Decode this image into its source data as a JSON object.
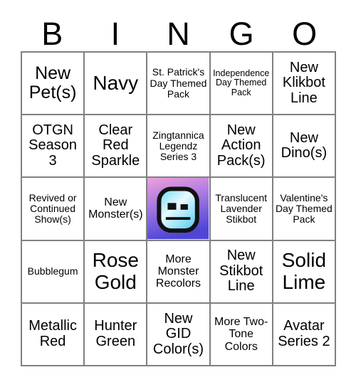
{
  "card": {
    "header_letters": [
      "B",
      "I",
      "N",
      "G",
      "O"
    ],
    "free_space": {
      "icon": "stikbot-head-icon",
      "gradient_top": "#ef9fdc",
      "gradient_mid": "#a87ae2",
      "gradient_bottom": "#4f46d6",
      "head_color": "#79dcf5",
      "head_highlight": "#e8f9ff",
      "outline_color": "#111111"
    },
    "rows": [
      [
        {
          "text": "New Pet(s)",
          "size": "fs-lg"
        },
        {
          "text": "Navy",
          "size": "fs-xl"
        },
        {
          "text": "St. Patrick's Day Themed Pack",
          "size": "fs-xs"
        },
        {
          "text": "Independence Day Themed Pack",
          "size": "fs-xxs"
        },
        {
          "text": "New Klikbot Line",
          "size": "fs-md"
        }
      ],
      [
        {
          "text": "OTGN Season 3",
          "size": "fs-md"
        },
        {
          "text": "Clear Red Sparkle",
          "size": "fs-md"
        },
        {
          "text": "Zingtannica Legendz Series 3",
          "size": "fs-xs"
        },
        {
          "text": "New Action Pack(s)",
          "size": "fs-md"
        },
        {
          "text": "New Dino(s)",
          "size": "fs-md"
        }
      ],
      [
        {
          "text": "Revived or Continued Show(s)",
          "size": "fs-xs"
        },
        {
          "text": "New Monster(s)",
          "size": "fs-sm"
        },
        {
          "text": "",
          "size": "free"
        },
        {
          "text": "Translucent Lavender Stikbot",
          "size": "fs-xs"
        },
        {
          "text": "Valentine's Day Themed Pack",
          "size": "fs-xs"
        }
      ],
      [
        {
          "text": "Bubblegum",
          "size": "fs-xs"
        },
        {
          "text": "Rose Gold",
          "size": "fs-xl"
        },
        {
          "text": "More Monster Recolors",
          "size": "fs-sm"
        },
        {
          "text": "New Stikbot Line",
          "size": "fs-md"
        },
        {
          "text": "Solid Lime",
          "size": "fs-xl"
        }
      ],
      [
        {
          "text": "Metallic Red",
          "size": "fs-md"
        },
        {
          "text": "Hunter Green",
          "size": "fs-md"
        },
        {
          "text": "New GID Color(s)",
          "size": "fs-md"
        },
        {
          "text": "More Two-Tone Colors",
          "size": "fs-sm"
        },
        {
          "text": "Avatar Series 2",
          "size": "fs-md"
        }
      ]
    ]
  }
}
